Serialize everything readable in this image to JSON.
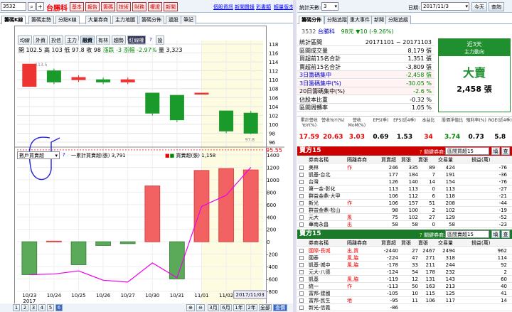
{
  "top": {
    "code": "3532",
    "name": "台勝科",
    "tabs": [
      "基本",
      "報告",
      "籌碼",
      "技術",
      "財務",
      "權證",
      "新聞"
    ],
    "links": [
      "個股資訊",
      "新聞聲援",
      "彩書類",
      "輕量版本"
    ]
  },
  "chart_tabs": [
    "籌碼K線",
    "籌碼走勢",
    "分點K線",
    "大量券商",
    "主力地圖",
    "籌碼分佈",
    "遞股",
    "筆記"
  ],
  "indicator_tabs": [
    "均線",
    "外資",
    "投信",
    "主力",
    "融資",
    "有林",
    "趨勢",
    "紅線權",
    "?",
    "設"
  ],
  "ohlc": {
    "open": "開 102.5",
    "high": "高 103",
    "low": "低 97.8",
    "close": "收 98",
    "chg": "漲跌 -3",
    "pct": "漲幅 -2.97%",
    "vol": "量 3,323"
  },
  "price_axis": [
    "118",
    "116",
    "114",
    "112",
    "110",
    "108",
    "106",
    "104",
    "102",
    "100",
    "98",
    "96"
  ],
  "cost_label": "95.55",
  "annot_top": "113.5",
  "annot_low": "97.8",
  "sub_select": "數戶買賣超",
  "sub_legend1": "一累計買賣超(張)",
  "sub_legend1_val": "3,791",
  "sub_legend2": "買賣超(張)",
  "sub_legend2_val": "1,158",
  "sub_axis": [
    "1400",
    "1200",
    "1000",
    "800",
    "600",
    "400",
    "200",
    "0",
    "-200",
    "-400",
    "-600",
    "-800"
  ],
  "dates": [
    "10/23",
    "10/24",
    "10/25",
    "10/26",
    "10/27",
    "10/30",
    "10/31",
    "11/01",
    "11/02"
  ],
  "date_year": "2017",
  "date_end": "2017/11/03",
  "pages": [
    "1",
    "2",
    "3",
    "4",
    "5",
    "6"
  ],
  "range_btns": [
    "3月",
    "6月",
    "1年",
    "2年",
    "全部",
    "查價"
  ],
  "right_top": {
    "period_label": "統計天數:",
    "period_val": "3",
    "date_label": "日期:",
    "date_val": "2017/11/3",
    "today": "今天",
    "inquiry": "查詢"
  },
  "right_tabs": [
    "籌碼分佈",
    "分點追蹤",
    "重大事件",
    "新聞",
    "分點追縱"
  ],
  "stock_line": {
    "code": "3532",
    "name": "台勝科",
    "price": "98元",
    "chg": "▼10 (-9.26%)"
  },
  "stats": [
    {
      "k": "統計區間",
      "v": "20171101 ~ 20171103"
    },
    {
      "k": "區間成交量",
      "v": "8,179 張"
    },
    {
      "k": "買超前15名合計",
      "v": "1,351 張"
    },
    {
      "k": "賣超前15名合計",
      "v": "-3,809 張"
    },
    {
      "k": "3日籌碼集中",
      "v": "-2,458 張"
    },
    {
      "k": "3日籌碼集中(%)",
      "v": "-30.05 %"
    },
    {
      "k": "20日籌碼集中(%)",
      "v": "-2.6 %"
    },
    {
      "k": "佔股本比重",
      "v": "-0.32 %"
    },
    {
      "k": "區間周轉率",
      "v": "1.05 %"
    }
  ],
  "green_box": {
    "t1": "近3天",
    "t2": "主力動向",
    "big": "大賣",
    "amt": "2,458 張"
  },
  "fund": {
    "heads": [
      "累計營收YoY(%)",
      "營收YoY(%)",
      "營收MoM(%)",
      "EPS(季)",
      "EPS(近4季)",
      "本益比",
      "股價淨值比",
      "殖利率(%)",
      "ROE(近4季)"
    ],
    "vals": [
      "17.59",
      "20.63",
      "3.03",
      "0.69",
      "1.53",
      "34",
      "3.74",
      "0.73",
      "5.8"
    ]
  },
  "buy": {
    "title": "賣方15",
    "question": "關鍵券商:",
    "select": "區間買超15",
    "b1": "填",
    "b2": "查",
    "cols": [
      "券商名稱",
      "隔離券商",
      "買賣超",
      "買張",
      "賣張",
      "交易量",
      "損益(萬)"
    ],
    "rows": [
      [
        "美林",
        "作",
        "246",
        "335",
        "89",
        "424",
        "-76"
      ],
      [
        "凱基-台北",
        "",
        "177",
        "184",
        "7",
        "191",
        "-36"
      ],
      [
        "台灣",
        "",
        "126",
        "140",
        "14",
        "154",
        "-76"
      ],
      [
        "第一金-彰化",
        "",
        "113",
        "113",
        "0",
        "113",
        "-27"
      ],
      [
        "群益金鼎-大甲",
        "",
        "106",
        "112",
        "6",
        "118",
        "-21"
      ],
      [
        "新光",
        "作",
        "106",
        "157",
        "51",
        "208",
        "-44"
      ],
      [
        "群益金鼎-松山",
        "",
        "98",
        "100",
        "2",
        "102",
        "-19"
      ],
      [
        "元大",
        "風",
        "75",
        "102",
        "27",
        "129",
        "-52"
      ],
      [
        "華南永昌",
        "出",
        "58",
        "58",
        "0",
        "58",
        "-23"
      ]
    ]
  },
  "sell": {
    "title": "賣方15",
    "question": "關鍵券商:",
    "select": "區間賣超15",
    "b1": "填",
    "b2": "查",
    "cols": [
      "券商名稱",
      "隔離券商",
      "買賣超",
      "買張",
      "賣張",
      "交易量",
      "損益(萬)"
    ],
    "rows": [
      [
        "國際-長城",
        "出,資",
        "-2440",
        "27",
        "2467",
        "2494",
        "962"
      ],
      [
        "國泰",
        "風,脇",
        "-224",
        "47",
        "271",
        "318",
        "114"
      ],
      [
        "凱基-城中",
        "風,脇",
        "-178",
        "33",
        "211",
        "244",
        "92"
      ],
      [
        "元大-八德",
        "",
        "-124",
        "54",
        "178",
        "232",
        "2"
      ],
      [
        "凱基",
        "風,脇",
        "-119",
        "12",
        "131",
        "143",
        "60"
      ],
      [
        "統一",
        "作",
        "-113",
        "50",
        "163",
        "213",
        "40"
      ],
      [
        "富邦-建國",
        "",
        "-105",
        "10",
        "115",
        "125",
        "41"
      ],
      [
        "富邦-民生",
        "地",
        "-95",
        "11",
        "106",
        "117",
        "14"
      ],
      [
        "新光-信義",
        "",
        "-86",
        "",
        "",
        "",
        ""
      ]
    ]
  },
  "chart_data": {
    "type": "candlestick",
    "dates": [
      "10/23",
      "10/24",
      "10/25",
      "10/26",
      "10/27",
      "10/30",
      "10/31",
      "11/01",
      "11/02",
      "11/03"
    ],
    "candles": [
      {
        "o": 108.5,
        "c": 113.5,
        "h": 113.5,
        "l": 108.5
      },
      {
        "o": 112,
        "c": 109.5,
        "h": 112.5,
        "l": 109
      },
      {
        "o": 110,
        "c": 110.5,
        "h": 111,
        "l": 109.5
      },
      {
        "o": 110,
        "c": 109.5,
        "h": 110.5,
        "l": 109
      },
      {
        "o": 109.5,
        "c": 110,
        "h": 110.5,
        "l": 109
      },
      {
        "o": 107,
        "c": 102.5,
        "h": 107,
        "l": 102
      },
      {
        "o": 106.5,
        "c": 101,
        "h": 106.5,
        "l": 100.5
      },
      {
        "o": 107,
        "c": 107,
        "h": 107,
        "l": 107
      },
      {
        "o": 103,
        "c": 98.5,
        "h": 103,
        "l": 98
      },
      {
        "o": 102.5,
        "c": 98,
        "h": 103,
        "l": 97.8
      }
    ],
    "bars": [
      -530,
      10,
      -370,
      -60,
      -30,
      900,
      -600,
      1150,
      1180,
      1158
    ],
    "cumulative": [
      -530,
      -520,
      -470,
      -620,
      -650,
      -340,
      -580,
      570,
      750,
      1200
    ],
    "ylim_price": [
      96,
      118
    ],
    "ylim_sub": [
      -800,
      1400
    ]
  }
}
